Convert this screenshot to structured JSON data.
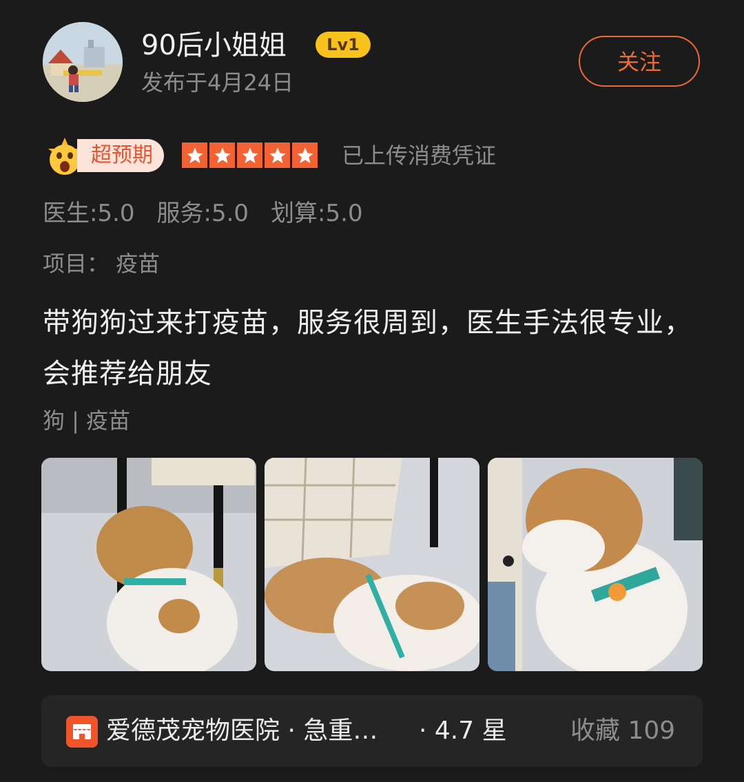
{
  "user": {
    "name": "90后小姐姐",
    "level": "Lv1",
    "published": "发布于4月24日",
    "follow_label": "关注"
  },
  "rating": {
    "badge": "超预期",
    "stars": 5,
    "voucher": "已上传消费凭证"
  },
  "scores": [
    {
      "label": "医生:5.0"
    },
    {
      "label": "服务:5.0"
    },
    {
      "label": "划算:5.0"
    }
  ],
  "project": "项目：  疫苗",
  "content": "带狗狗过来打疫苗，服务很周到，医生手法很专业，会推荐给朋友",
  "tags": "狗 | 疫苗",
  "shop": {
    "name": "爱德茂宠物医院 · 急重…",
    "rating": "· 4.7 星",
    "favorites": "收藏 109"
  },
  "colors": {
    "accent": "#f06a35",
    "star": "#f26233",
    "level": "#f6c21b"
  }
}
